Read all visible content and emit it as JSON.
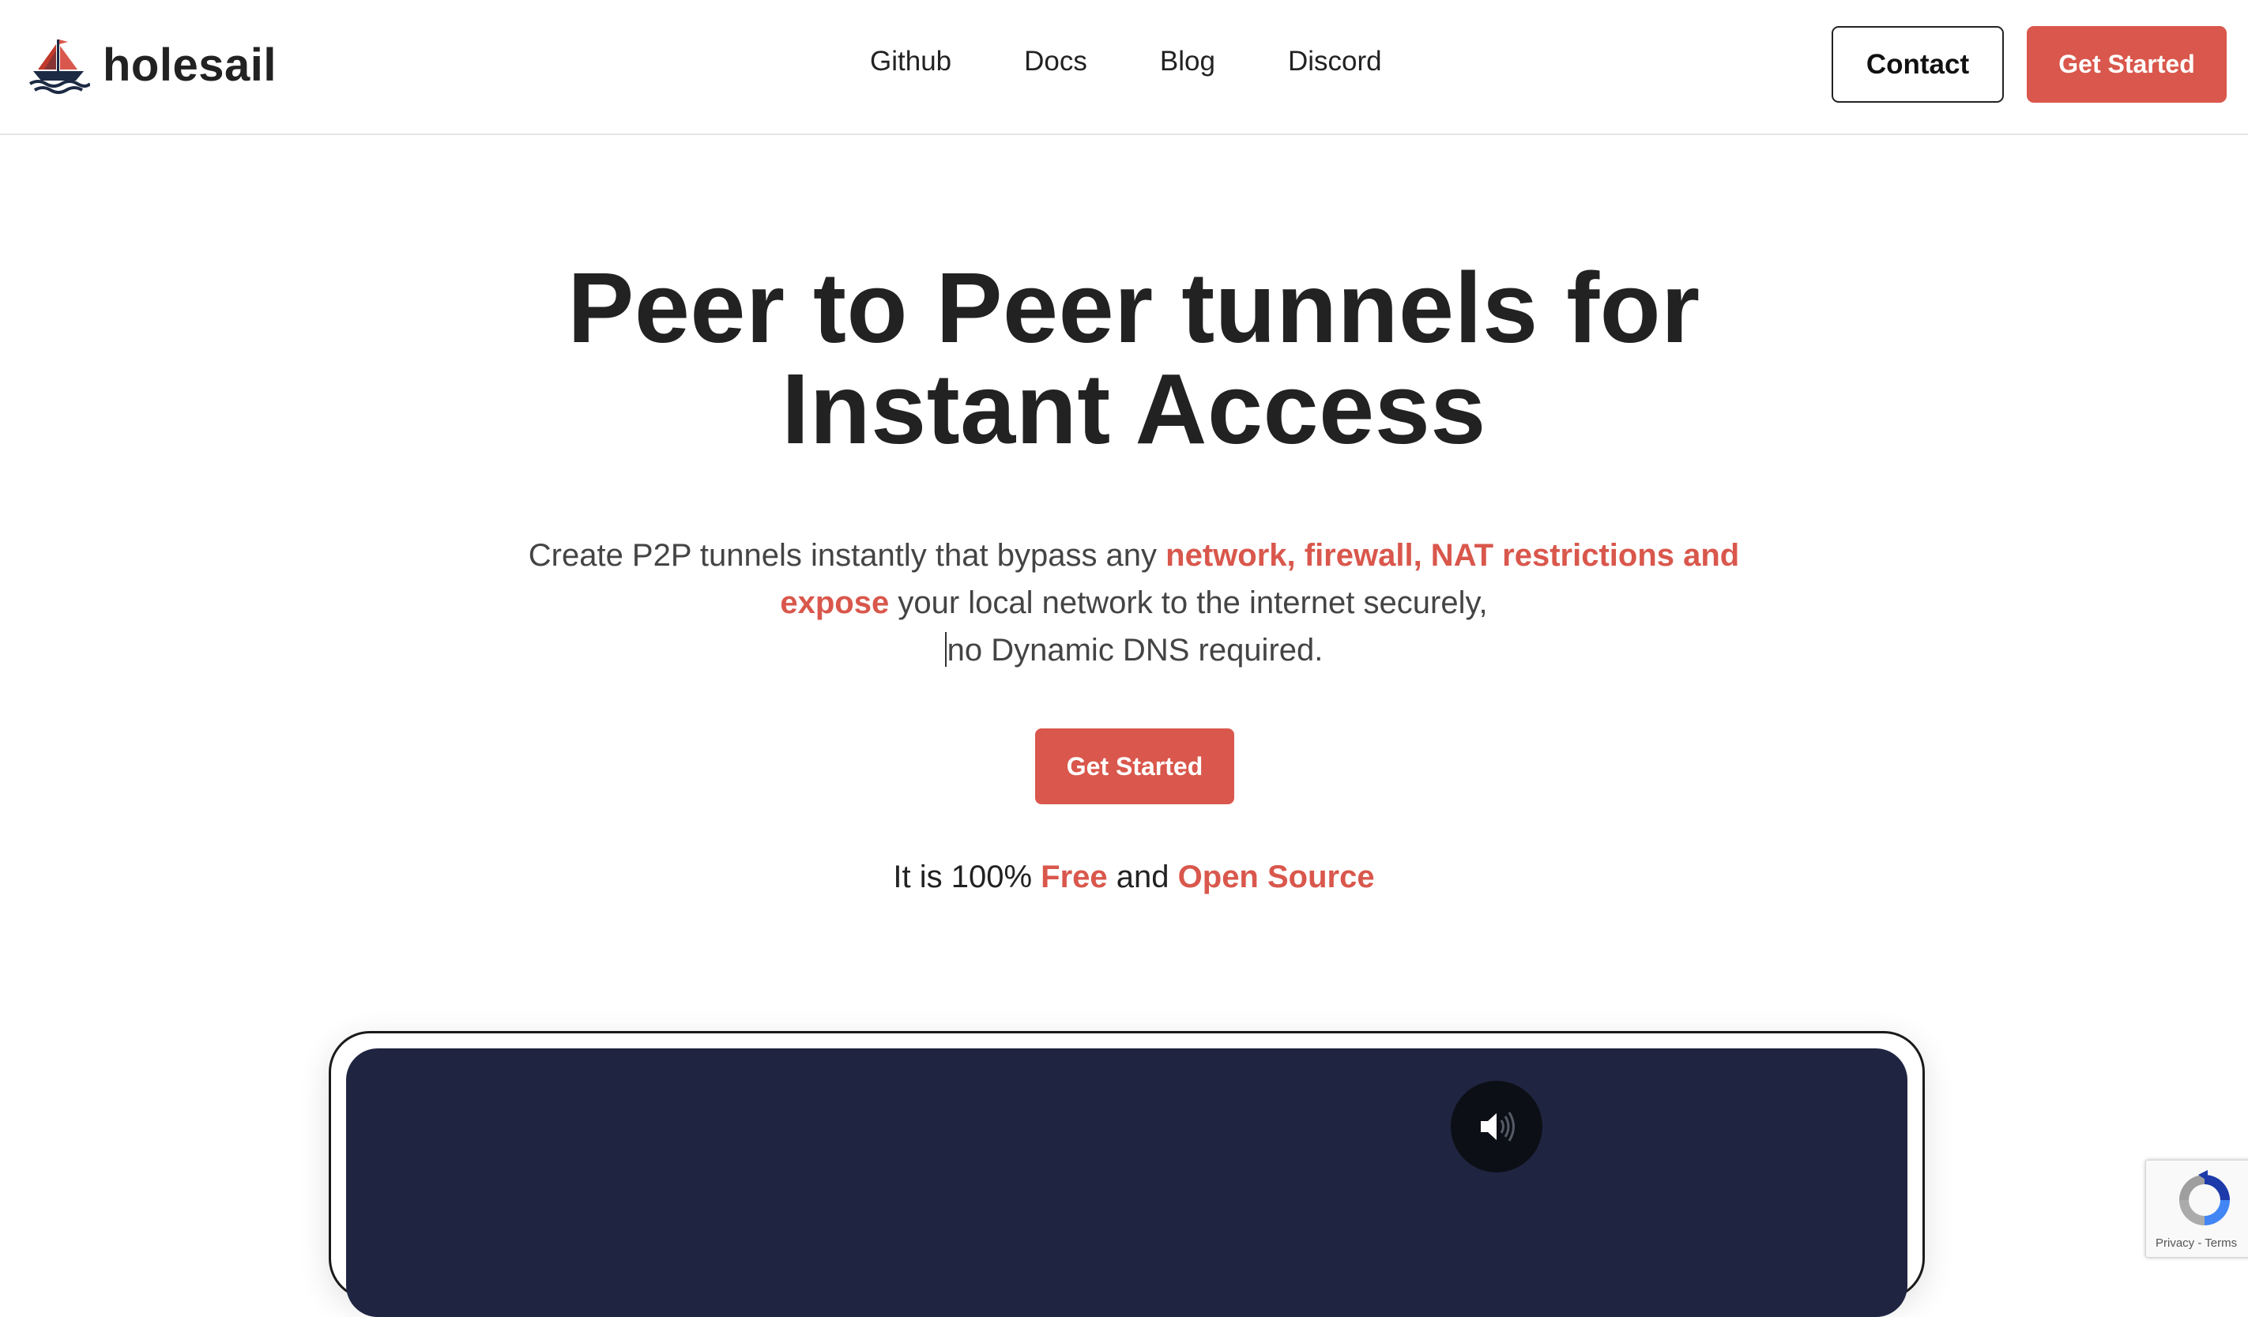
{
  "brand": {
    "name": "holesail",
    "logo_icon": "sailboat-icon",
    "accent_color": "#d9574c"
  },
  "nav": {
    "items": [
      "Github",
      "Docs",
      "Blog",
      "Discord"
    ]
  },
  "header_buttons": {
    "contact": "Contact",
    "get_started": "Get Started"
  },
  "hero": {
    "title_line1": "Peer to Peer tunnels for",
    "title_line2": "Instant Access",
    "desc_part1": "Create P2P tunnels instantly that bypass any ",
    "desc_highlight": "network, firewall, NAT restrictions and expose",
    "desc_part2": " your local network to the internet securely,",
    "desc_part3": "no Dynamic DNS required.",
    "cta": "Get Started",
    "oss_prefix": "It is 100% ",
    "oss_free": "Free",
    "oss_and": " and ",
    "oss_open_source": "Open Source"
  },
  "video": {
    "background_color": "#1f2541",
    "mute_icon": "volume-muted-icon"
  },
  "recaptcha": {
    "icon": "recaptcha-icon",
    "privacy": "Privacy",
    "separator": " - ",
    "terms": "Terms"
  }
}
